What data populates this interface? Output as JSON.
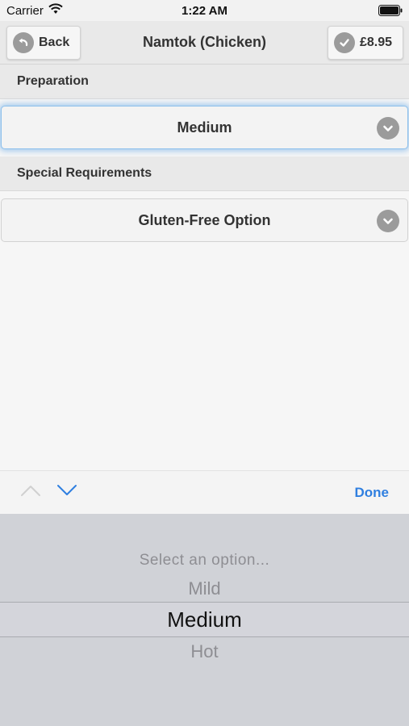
{
  "status_bar": {
    "carrier": "Carrier",
    "time": "1:22 AM"
  },
  "navbar": {
    "back_label": "Back",
    "title": "Namtok (Chicken)",
    "price_label": "£8.95"
  },
  "sections": [
    {
      "header": "Preparation",
      "selected": "Medium"
    },
    {
      "header": "Special Requirements",
      "selected": "Gluten-Free Option"
    }
  ],
  "toolbar": {
    "done_label": "Done"
  },
  "picker": {
    "options": [
      "Select an option...",
      "Mild",
      "Medium",
      "Hot"
    ],
    "selected": "Medium"
  },
  "colors": {
    "accent": "#2f7fe0",
    "focus_glow": "#58a0e6",
    "icon_gray": "#9b9b9b"
  }
}
